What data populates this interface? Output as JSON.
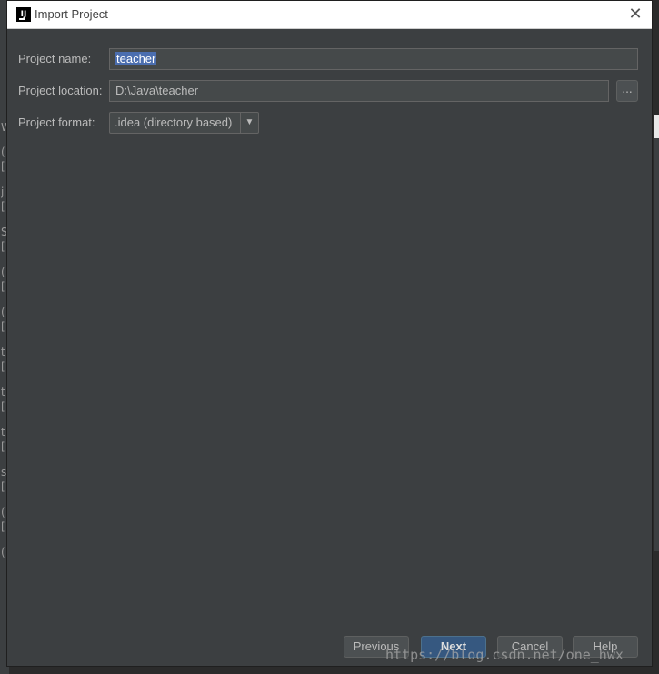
{
  "window": {
    "title": "Import Project",
    "close_glyph": "✕"
  },
  "form": {
    "name_label": "Project name:",
    "name_value": "teacher",
    "location_label": "Project location:",
    "location_value": "D:\\Java\\teacher",
    "browse_label": "...",
    "format_label": "Project format:",
    "format_value": ".idea (directory based)",
    "format_arrow": "▼"
  },
  "buttons": {
    "previous": "Previous",
    "next": "Next",
    "cancel": "Cancel",
    "help": "Help"
  },
  "background_glyphs": [
    "W",
    "(",
    "[",
    "j",
    "[",
    "S",
    "[",
    "(",
    "[",
    "(",
    "[",
    "t",
    "[",
    "t",
    "[",
    "t",
    "[",
    "s",
    "[",
    "(",
    "[",
    "("
  ],
  "watermark": "https://blog.csdn.net/one_hwx",
  "colors": {
    "dialog_bg": "#3c3f41",
    "field_bg": "#45494a",
    "selection": "#4b6eaf",
    "default_button": "#365880"
  },
  "icons": {
    "app": "intellij-icon",
    "close": "close-icon",
    "dropdown": "chevron-down-icon"
  }
}
